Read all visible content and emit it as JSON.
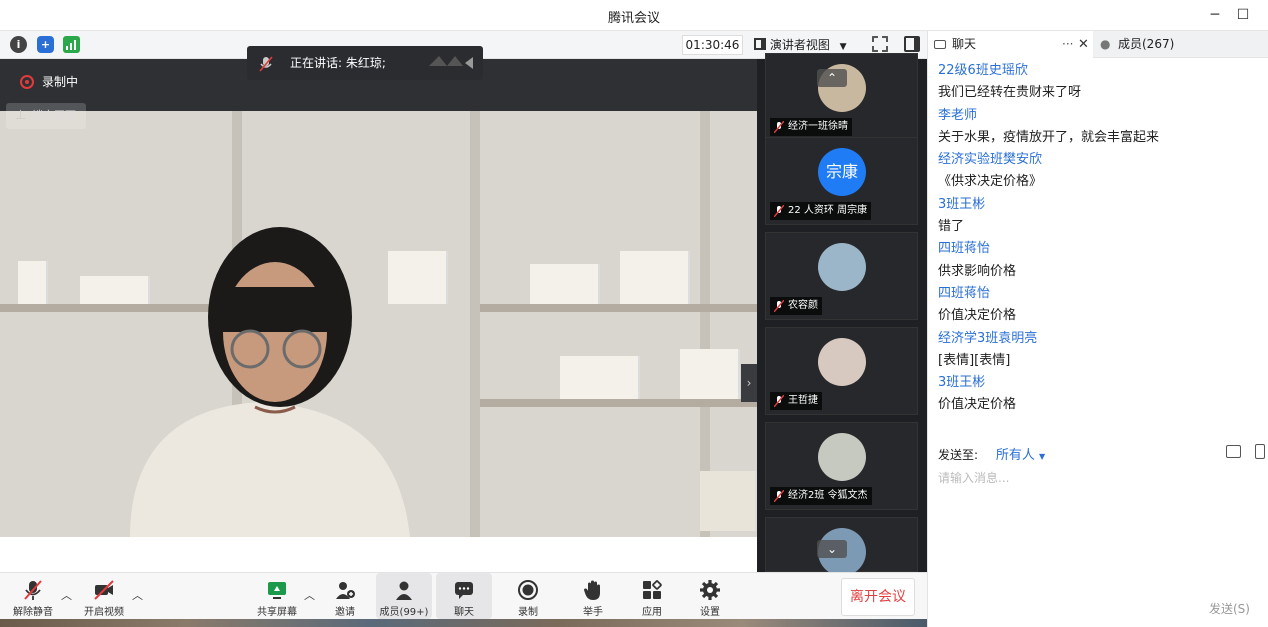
{
  "window": {
    "title": "腾讯会议",
    "minimize": "─",
    "maximize": "☐"
  },
  "toolbar": {
    "timer": "01:30:46",
    "view_label": "演讲者视图"
  },
  "video": {
    "recording_label": "录制中",
    "lock_label": "锁定画面",
    "speaking_label": "正在讲话: 朱红琼;"
  },
  "thumbnails": [
    {
      "name": "经济一班徐晴",
      "avatar_text": "",
      "color": "#c9b8a0"
    },
    {
      "name": "22 人资环 周宗康",
      "avatar_text": "宗康",
      "color": "#1f7cf5"
    },
    {
      "name": "农容颜",
      "avatar_text": "",
      "color": "#9bb6c9"
    },
    {
      "name": "王哲捷",
      "avatar_text": "",
      "color": "#d8c9c0"
    },
    {
      "name": "经济2班 令狐文杰",
      "avatar_text": "",
      "color": "#c5c9c0"
    }
  ],
  "bottombar": {
    "unmute": "解除静音",
    "start_video": "开启视频",
    "share_screen": "共享屏幕",
    "invite": "邀请",
    "members": "成员(99+)",
    "chat": "聊天",
    "record": "录制",
    "raise_hand": "举手",
    "apps": "应用",
    "settings": "设置",
    "leave": "离开会议"
  },
  "chat": {
    "tab_chat": "聊天",
    "tab_members": "成员(267)",
    "messages": [
      {
        "sender": "22级6班史瑶欣",
        "text": "我们已经转在贵财来了呀"
      },
      {
        "sender": "李老师",
        "text": "关于水果，疫情放开了，就会丰富起来"
      },
      {
        "sender": "经济实验班樊安欣",
        "text": "《供求决定价格》"
      },
      {
        "sender": "3班王彬",
        "text": "错了"
      },
      {
        "sender": "四班蒋怡",
        "text": "供求影响价格"
      },
      {
        "sender": "四班蒋怡",
        "text": "价值决定价格"
      },
      {
        "sender": "经济学3班袁明亮",
        "text": "[表情][表情]"
      },
      {
        "sender": "3班王彬",
        "text": "价值决定价格"
      }
    ],
    "send_to_label": "发送至:",
    "send_to_value": "所有人",
    "input_placeholder": "请输入消息...",
    "send_button": "发送(S)"
  }
}
